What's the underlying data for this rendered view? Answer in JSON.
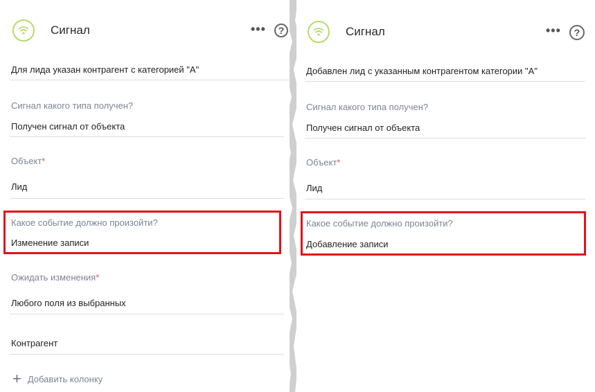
{
  "left": {
    "header": {
      "title": "Сигнал",
      "icon": "wifi-signal-icon",
      "more_icon": "•••",
      "help_icon": "?"
    },
    "description": "Для лида указан контрагент с категорией \"А\"",
    "fields": [
      {
        "label": "Сигнал какого типа получен?",
        "required": "",
        "value": "Получен сигнал от объекта"
      },
      {
        "label": "Объект",
        "required": "*",
        "value": "Лид"
      },
      {
        "label": "Какое событие должно произойти?",
        "required": "",
        "value": "Изменение записи"
      },
      {
        "label": "Ожидать изменения",
        "required": "*",
        "value": "Любого поля из выбранных"
      }
    ],
    "column_value": "Контрагент",
    "add_column_label": "Добавить колонку",
    "add_icon": "+"
  },
  "right": {
    "header": {
      "title": "Сигнал",
      "icon": "wifi-signal-icon",
      "more_icon": "•••",
      "help_icon": "?"
    },
    "description": "Добавлен лид с указанным контрагентом категории \"А\"",
    "fields": [
      {
        "label": "Сигнал какого типа получен?",
        "required": "",
        "value": "Получен сигнал от объекта"
      },
      {
        "label": "Объект",
        "required": "*",
        "value": "Лид"
      },
      {
        "label": "Какое событие должно произойти?",
        "required": "",
        "value": "Добавление записи"
      }
    ]
  },
  "colors": {
    "accent_icon": "#b7d96a",
    "highlight": "#e3101a",
    "label": "#7b8594",
    "required": "#e05252"
  }
}
